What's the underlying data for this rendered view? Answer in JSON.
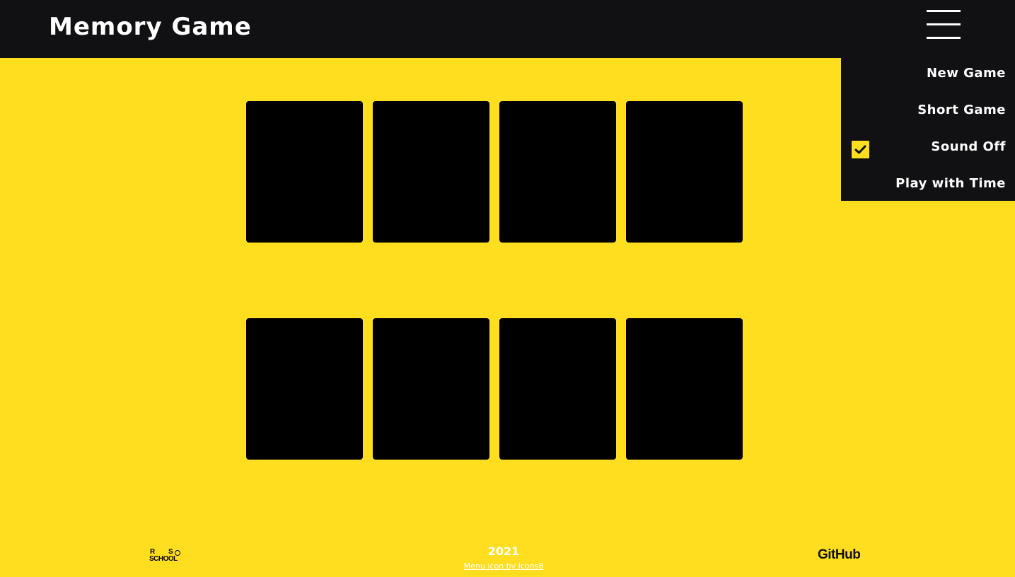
{
  "header": {
    "title": "Memory Game",
    "menu_icon": "hamburger-icon"
  },
  "menu": {
    "items": [
      {
        "label": "New Game"
      },
      {
        "label": "Short Game"
      },
      {
        "label": "Sound Off",
        "checked": true
      },
      {
        "label": "Play with Time"
      }
    ]
  },
  "board": {
    "cards_face_down": 8
  },
  "footer": {
    "logo_r": "R",
    "logo_s": "S",
    "logo_school": "SCHOOL",
    "year": "2021",
    "credit": "Menu icon by Icons8",
    "github": "GitHub"
  },
  "colors": {
    "background": "#ffde1f",
    "header": "#111113",
    "card_back": "#000000",
    "text_light": "#ffffff"
  }
}
